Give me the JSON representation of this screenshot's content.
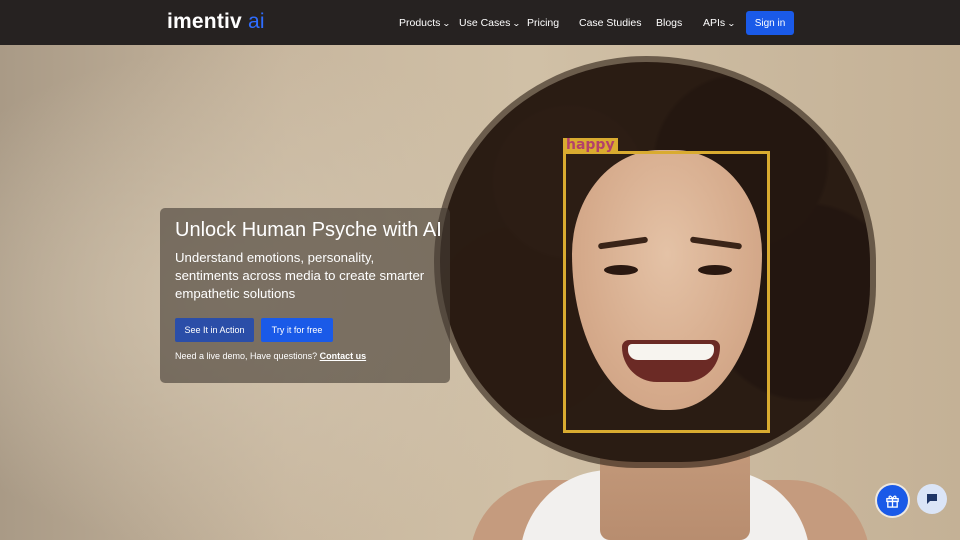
{
  "brand": {
    "logo_main": "imentiv",
    "logo_accent": "ai",
    "accent_color": "#1a5ae8"
  },
  "nav": {
    "items": [
      {
        "label": "Products",
        "dropdown": true
      },
      {
        "label": "Use Cases",
        "dropdown": true
      },
      {
        "label": "Pricing",
        "dropdown": false
      },
      {
        "label": "Case Studies",
        "dropdown": false
      },
      {
        "label": "Blogs",
        "dropdown": false
      },
      {
        "label": "APIs",
        "dropdown": true
      }
    ],
    "signin_label": "Sign in"
  },
  "hero": {
    "title": "Unlock Human Psyche with AI",
    "subtitle": "Understand emotions, personality, sentiments across media to create smarter empathetic solutions",
    "primary_button": "See It in Action",
    "secondary_button": "Try it for free",
    "demo_prefix": "Need a live demo, Have questions?",
    "demo_link": "Contact us"
  },
  "detection": {
    "label": "happy",
    "box_color": "#d9ab30"
  },
  "floating": {
    "gift_icon": "gift-icon",
    "chat_icon": "chat-icon"
  }
}
